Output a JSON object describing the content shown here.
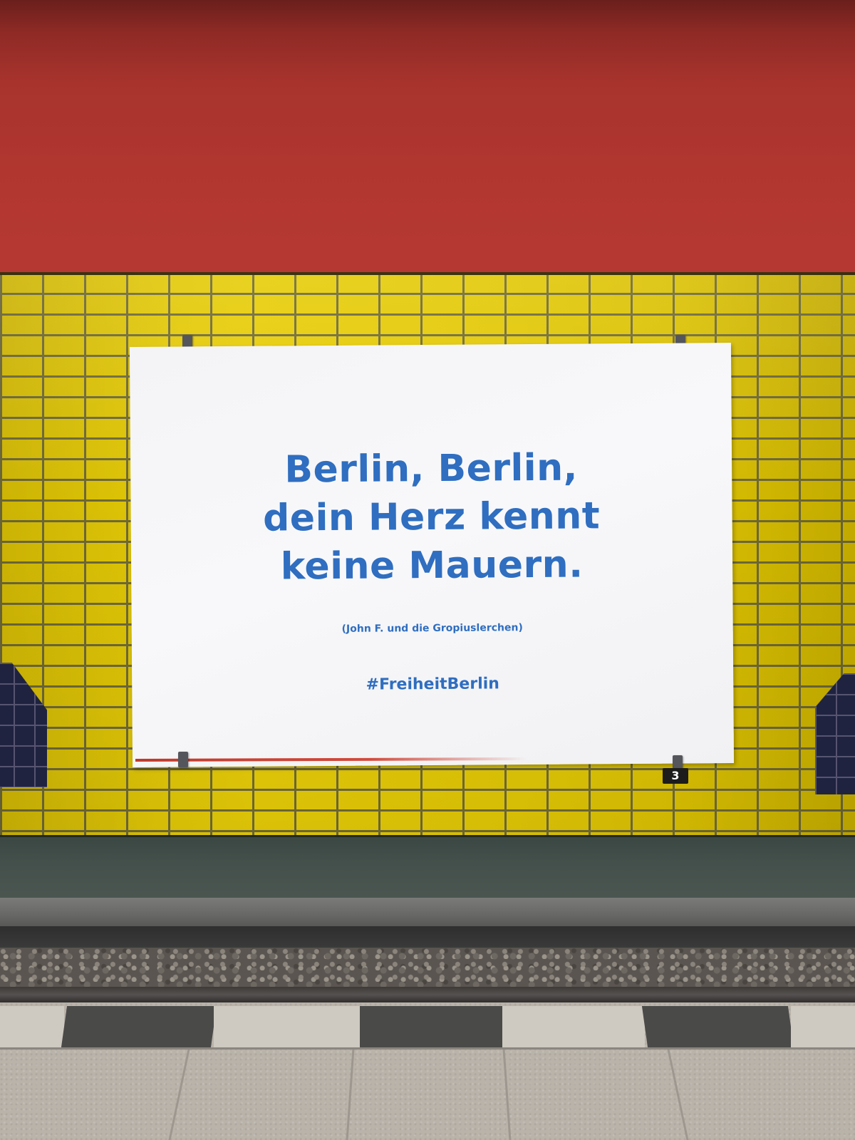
{
  "scene": "subway-station-wall",
  "colors": {
    "wall_red": "#b33731",
    "tile_yellow": "#e2c806",
    "poster_white": "#f6f6f8",
    "text_blue": "#2f6ec0"
  },
  "poster": {
    "quote_lines": [
      "Berlin, Berlin,",
      "dein Herz kennt",
      "keine Mauern."
    ],
    "attribution": "(John F. und die Gropiuslerchen)",
    "hashtag": "#FreiheitBerlin"
  },
  "platform_marker": "3"
}
